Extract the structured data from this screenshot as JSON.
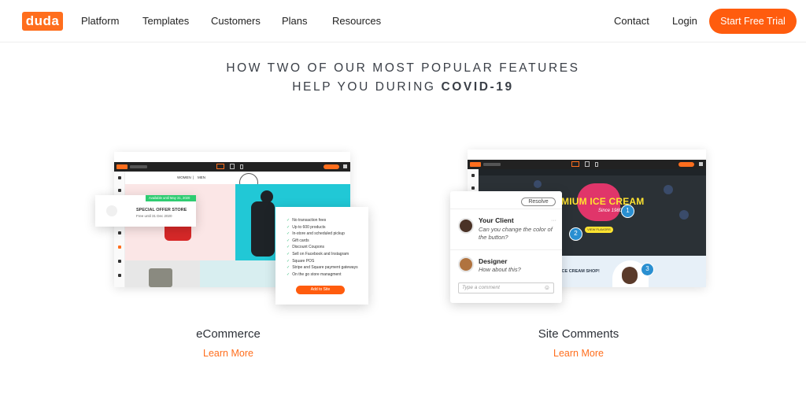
{
  "nav": {
    "logo": "duda",
    "links": [
      "Platform",
      "Templates",
      "Customers",
      "Plans",
      "Resources"
    ],
    "contact": "Contact",
    "login": "Login",
    "cta": "Start Free Trial"
  },
  "heading": {
    "line1": "HOW TWO OF OUR MOST POPULAR FEATURES",
    "line2_prefix": "HELP YOU DURING ",
    "line2_bold": "COVID-19"
  },
  "ecommerce": {
    "title": "eCommerce",
    "link": "Learn More",
    "page_nav": [
      "WOMEN",
      "MEN"
    ],
    "offer_badge": "Available until May 31, 2020",
    "offer_title": "SPECIAL OFFER STORE",
    "offer_sub": "Free until 31 Dec 2020",
    "features": [
      "No transaction fees",
      "Up to 600 products",
      "In-store and scheduled pickup",
      "Gift cards",
      "Discount Coupons",
      "Sell on Facebook and Instagram",
      "Square POS",
      "Stripe and Square payment gateways",
      "On the go store managment"
    ],
    "add_button": "Add to Site"
  },
  "comments": {
    "title": "Site Comments",
    "link": "Learn More",
    "resolve": "Resolve",
    "client_name": "Your Client",
    "client_text": "Can you change the color of the button?",
    "designer_name": "Designer",
    "designer_text": "How about this?",
    "input_placeholder": "Type a comment",
    "hero_text": "MIUM ICE CREAM",
    "hero_sub": "Since 1980",
    "hero_button": "VIEW FLAVORS",
    "shop_text": "ICE CREAM SHOP!",
    "badges": [
      "1",
      "2",
      "3"
    ]
  },
  "colors": {
    "brand": "#ff6e1d",
    "cta": "#ff5c0e",
    "badge": "#2a8fd1",
    "green": "#3cbf7f"
  }
}
